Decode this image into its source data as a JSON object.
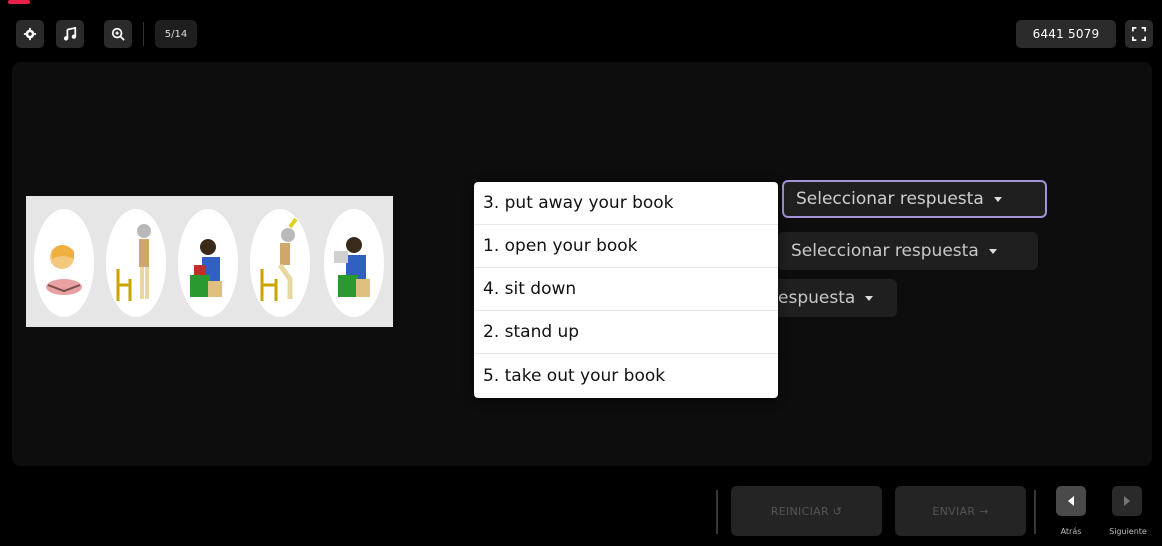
{
  "topbar": {
    "settings_icon": "gear-icon",
    "music_icon": "music-note-icon",
    "zoom_icon": "zoom-in-icon",
    "page_counter": "5/14",
    "code": "6441 5079",
    "fullscreen_icon": "fullscreen-icon"
  },
  "activity": {
    "options": [
      "3. put away your book",
      "1. open your book",
      "4. sit down",
      "2. stand up",
      "5. take out your book"
    ],
    "selects": [
      {
        "label": "Seleccionar respuesta"
      },
      {
        "label": "Seleccionar respuesta"
      },
      {
        "label": "espuesta"
      }
    ]
  },
  "footer": {
    "restart_label": "REINICIAR ↺",
    "submit_label": "ENVIAR →",
    "back_label": "Atrás",
    "next_label": "Siguiente"
  },
  "colors": {
    "accent_progress": "#e8204a",
    "select_focus": "#a493d6"
  }
}
